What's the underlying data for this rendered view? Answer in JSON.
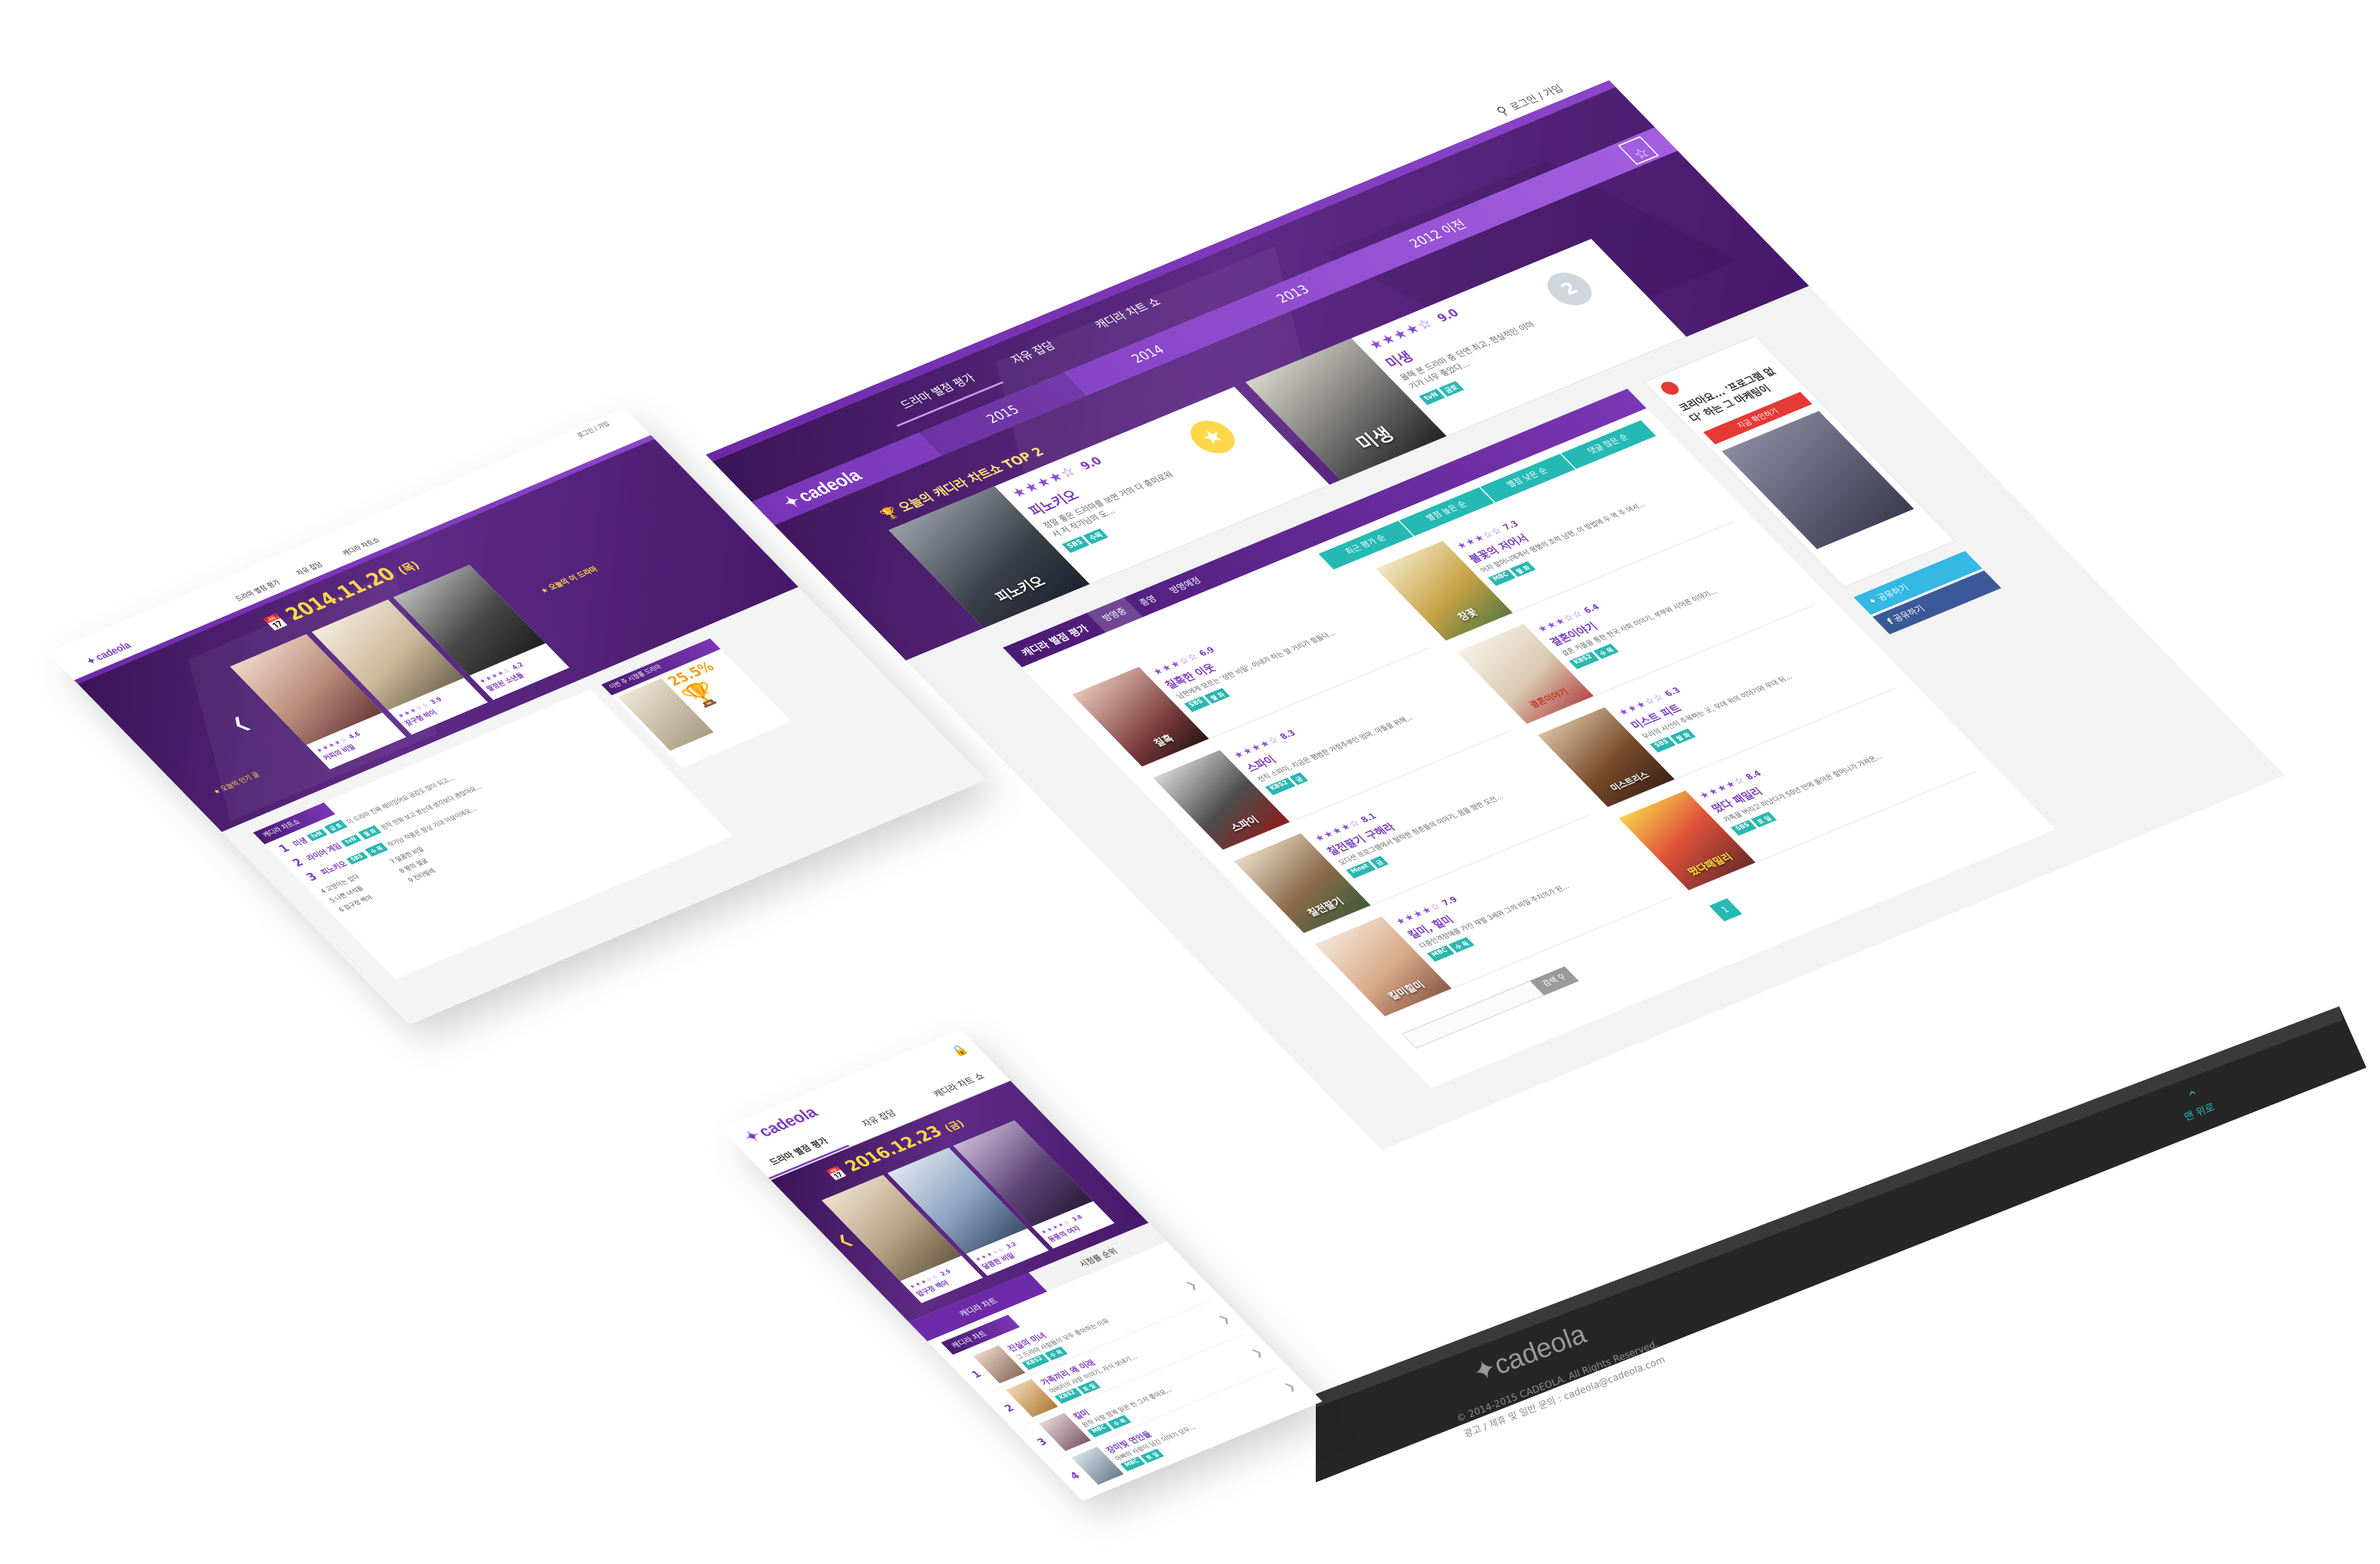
{
  "brand": {
    "logo": "cadeola",
    "primary": "#6d2aa8",
    "accent": "#25b9b4",
    "star": "#8b4fd4"
  },
  "main": {
    "login": "로그인 / 가입",
    "nav": [
      "드라마 별점 평가",
      "자유 잡담",
      "캐디라 차트 쇼"
    ],
    "years": [
      "2015",
      "2014",
      "2013",
      "2012 이전"
    ],
    "top2_title": "오늘의 캐디라 차트쇼 TOP 2",
    "top2": [
      {
        "poster": "피노키오",
        "title": "피노키오",
        "score": "9.0",
        "desc": "정말 좋은 드라마를 보면 거의 다 흥미로워서 저 작가님의 도...",
        "tags": [
          "SBS",
          "수목"
        ]
      },
      {
        "poster": "미생",
        "title": "미생",
        "score": "9.0",
        "desc": "올해 본 드라마 중 단연 최고, 현실적인 이야기가 너무 좋았다...",
        "tags": [
          "tvN",
          "금토"
        ]
      }
    ],
    "grid_label": "캐디라 별점 평가",
    "grid_tabs": [
      "방영중",
      "종영",
      "방영예정"
    ],
    "sort_tabs": [
      "최근 평가 순",
      "별점 높은 순",
      "별점 낮은 순",
      "댓글 많은 순"
    ],
    "items": [
      {
        "poster": "칠흑",
        "title": "칠흑한 이웃",
        "score": "6.9",
        "desc": "남편에게 모르는 '상한 비밀', 이내가 하는 말 거리가 힘들다...",
        "tags": [
          "SBS",
          "월 화"
        ]
      },
      {
        "poster": "창꽃",
        "title": "불꽃의 저어서",
        "score": "7.3",
        "desc": "어차 할머니에게서 평행의 조력 남편, 이 방법에 두 역 주 여서...",
        "tags": [
          "MBC",
          "월 화"
        ]
      },
      {
        "poster": "스파이",
        "title": "스파이",
        "score": "8.3",
        "desc": "전직 스파이, 지금은 평범한 가정주부인 엄마, 아들을 위해...",
        "tags": [
          "KBS2",
          "금"
        ]
      },
      {
        "poster": "결혼이야기",
        "title": "결혼이야기",
        "score": "6.4",
        "desc": "결혼 커플을 통한 한국 사회 이야기, 부부와 시어른 이야기...",
        "tags": [
          "KBS2",
          "수 목"
        ]
      },
      {
        "poster": "칠전팔기",
        "title": "칠전팔기 구해라",
        "score": "8.1",
        "desc": "오디션 프로그램에서 탈락한 청춘들의 이야기, 꿈을 향한 도전...",
        "tags": [
          "Mnet",
          "금"
        ]
      },
      {
        "poster": "미스트리스",
        "title": "미스트 피트",
        "score": "6.3",
        "desc": "우리의 시선이 주목하는 곳, 무대 위의 이야기와 무대 뒤...",
        "tags": [
          "SBS",
          "월 화"
        ]
      },
      {
        "poster": "킬미힐미",
        "title": "킬미, 힐미",
        "score": "7.9",
        "desc": "다중인격장애를 가진 재벌 3세와 그의 비밀 주치의가 된...",
        "tags": [
          "MBC",
          "수 목"
        ]
      },
      {
        "poster": "떴다패밀리",
        "title": "떴다 패밀리",
        "score": "8.4",
        "desc": "가족을 버리고 떠났다가 50년 만에 돌아온 할머니가 가져온...",
        "tags": [
          "SBS",
          "토 일"
        ]
      }
    ],
    "ad_title": "코리아요... '프로그램 없다' 하는 그 마케팅이",
    "ad_button": "지금 확인하기",
    "share_twitter": "공유하기",
    "share_facebook": "공유하기",
    "search_label": "검색",
    "page": "1",
    "top_link": "맨 위로",
    "footer_copyright": "© 2014-2015 CADEOLA. All Rights Reserved.",
    "footer_contact": "광고 / 제휴 및 일반 문의 : cadeola@cadeola.com"
  },
  "laptop": {
    "login": "로그인 / 가입",
    "nav": [
      "드라마 별점 평가",
      "자유 잡담",
      "캐디라 차트쇼"
    ],
    "date": "2014.11.20",
    "weekday": "(목)",
    "posters": [
      {
        "title": "커피의 비밀",
        "score": "4.6"
      },
      {
        "title": "장구형 박이",
        "score": "3.9"
      },
      {
        "title": "딸정된 소년들",
        "score": "4.2"
      }
    ],
    "chart_label": "캐디라 차트쇼",
    "chart_rows": [
      {
        "rank": "1",
        "title": "미생",
        "tags": [
          "tvN",
          "금 토"
        ],
        "desc": "이 드라마 진짜 재미있어요 공감도 많이 되고..."
      },
      {
        "rank": "2",
        "title": "라이어 게임",
        "tags": [
          "tvN",
          "월 화"
        ],
        "desc": "원작 만화 보고 봤는데 생각보다 괜찮아요..."
      },
      {
        "rank": "3",
        "title": "피노키오",
        "tags": [
          "SBS",
          "수 목"
        ],
        "desc": "작가님 작품은 항상 기대 이상이에요..."
      }
    ],
    "list_left": [
      "4  고양이는 있다",
      "5  나쁜 녀석들",
      "6  압구정 백야"
    ],
    "list_right": [
      "7  달콤한 비밀",
      "8  왕의 얼굴",
      "9  칸타빌레"
    ],
    "today_label": "오늘의 인기 글",
    "ranking_label": "이번 주 시청률 드라마",
    "percent": "25.5%",
    "today_pick": "오늘의 이 드라마"
  },
  "mobile": {
    "nav": [
      "드라마 별점 평가",
      "자유 잡담",
      "캐디라 차트 쇼"
    ],
    "date": "2016.12.23",
    "weekday": "(금)",
    "posters": [
      {
        "title": "압구정 백야",
        "score": "2.9"
      },
      {
        "title": "달콤한 비밀",
        "score": "3.2"
      },
      {
        "title": "동풍의 여자",
        "score": "3.8"
      }
    ],
    "tabs": [
      "캐디라 차트",
      "시청률 순위"
    ],
    "chart_label": "캐디라 차트",
    "rows": [
      {
        "rank": "1",
        "title": "진실의 미녀",
        "desc": "그 드라마 사람들이 모두 좋아하는 이유",
        "tags": [
          "KBS2",
          "수 목"
        ]
      },
      {
        "rank": "2",
        "title": "가족끼리 왜 이래",
        "desc": "아버지의 사랑 이야기, 자식 보내기...",
        "tags": [
          "KBS2",
          "토 일"
        ]
      },
      {
        "rank": "3",
        "title": "킬미",
        "desc": "원작 사람 함께 읽은 전 그저 좋아요...",
        "tags": [
          "MBC",
          "수 목"
        ]
      },
      {
        "rank": "4",
        "title": "장미빛 연인들",
        "desc": "아빠의 사랑이 담긴 이야기 모두...",
        "tags": [
          "MBC",
          "토 일"
        ]
      }
    ]
  }
}
